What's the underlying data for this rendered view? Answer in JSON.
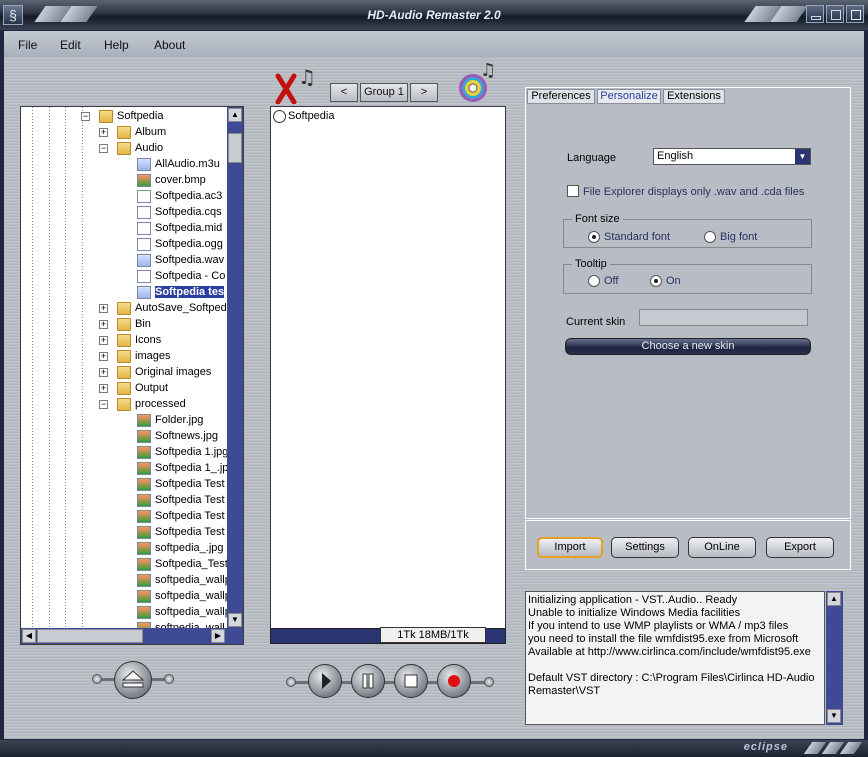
{
  "window": {
    "title": "HD-Audio Remaster 2.0",
    "brand": "eclipse"
  },
  "menu": [
    "File",
    "Edit",
    "Help",
    "About"
  ],
  "tree": {
    "items": [
      {
        "label": "Softpedia",
        "level": 0,
        "type": "folder",
        "expander": "minus"
      },
      {
        "label": "Album",
        "level": 1,
        "type": "folder",
        "expander": "plus"
      },
      {
        "label": "Audio",
        "level": 1,
        "type": "folder",
        "expander": "minus"
      },
      {
        "label": "AllAudio.m3u",
        "level": 2,
        "type": "file-blue"
      },
      {
        "label": "cover.bmp",
        "level": 2,
        "type": "file-img"
      },
      {
        "label": "Softpedia.ac3",
        "level": 2,
        "type": "file"
      },
      {
        "label": "Softpedia.cqs",
        "level": 2,
        "type": "file-plain"
      },
      {
        "label": "Softpedia.mid",
        "level": 2,
        "type": "file"
      },
      {
        "label": "Softpedia.ogg",
        "level": 2,
        "type": "file"
      },
      {
        "label": "Softpedia.wav",
        "level": 2,
        "type": "file-blue"
      },
      {
        "label": "Softpedia - Co",
        "level": 2,
        "type": "file"
      },
      {
        "label": "Softpedia tes",
        "level": 2,
        "type": "file-blue",
        "selected": true
      },
      {
        "label": "AutoSave_Softped",
        "level": 1,
        "type": "folder",
        "expander": "plus"
      },
      {
        "label": "Bin",
        "level": 1,
        "type": "folder",
        "expander": "plus"
      },
      {
        "label": "Icons",
        "level": 1,
        "type": "folder",
        "expander": "plus"
      },
      {
        "label": "images",
        "level": 1,
        "type": "folder",
        "expander": "plus"
      },
      {
        "label": "Original images",
        "level": 1,
        "type": "folder",
        "expander": "plus"
      },
      {
        "label": "Output",
        "level": 1,
        "type": "folder",
        "expander": "plus"
      },
      {
        "label": "processed",
        "level": 1,
        "type": "folder",
        "expander": "minus"
      },
      {
        "label": "Folder.jpg",
        "level": 2,
        "type": "file-img"
      },
      {
        "label": "Softnews.jpg",
        "level": 2,
        "type": "file-img"
      },
      {
        "label": "Softpedia 1.jpg",
        "level": 2,
        "type": "file-img"
      },
      {
        "label": "Softpedia 1_.jp",
        "level": 2,
        "type": "file-img"
      },
      {
        "label": "Softpedia Test",
        "level": 2,
        "type": "file-img"
      },
      {
        "label": "Softpedia Test",
        "level": 2,
        "type": "file-img"
      },
      {
        "label": "Softpedia Test",
        "level": 2,
        "type": "file-img"
      },
      {
        "label": "Softpedia Test",
        "level": 2,
        "type": "file-img"
      },
      {
        "label": "softpedia_.jpg",
        "level": 2,
        "type": "file-img"
      },
      {
        "label": "Softpedia_Test",
        "level": 2,
        "type": "file-img"
      },
      {
        "label": "softpedia_wallp",
        "level": 2,
        "type": "file-img"
      },
      {
        "label": "softpedia_wallp",
        "level": 2,
        "type": "file-img"
      },
      {
        "label": "softpedia_wallp",
        "level": 2,
        "type": "file-img"
      },
      {
        "label": "softpedia_wall",
        "level": 2,
        "type": "file-img"
      }
    ]
  },
  "group": {
    "prev": "<",
    "name": "Group 1",
    "next": ">"
  },
  "playlist": {
    "items": [
      "Softpedia"
    ],
    "status": "1Tk 18MB/1Tk"
  },
  "tabs": [
    "Preferences",
    "Personalize",
    "Extensions"
  ],
  "active_tab": "Personalize",
  "personalize": {
    "language_label": "Language",
    "language_value": "English",
    "file_explorer_label": "File Explorer displays only .wav and .cda files",
    "font_size": {
      "caption": "Font size",
      "standard": "Standard font",
      "big": "Big font",
      "selected": "standard"
    },
    "tooltip": {
      "caption": "Tooltip",
      "off": "Off",
      "on": "On",
      "selected": "on"
    },
    "current_skin_label": "Current skin",
    "current_skin_value": "",
    "choose_skin": "Choose a new skin"
  },
  "actions": [
    "Import",
    "Settings",
    "OnLine",
    "Export"
  ],
  "log": [
    "Initializing application - VST..Audio.. Ready",
    "Unable to initialize Windows Media facilities",
    "If you intend to use WMP playlists or WMA / mp3 files",
    "you need to install the file wmfdist95.exe from Microsoft",
    "Available at http://www.cirlinca.com/include/wmfdist95.exe",
    "",
    "Default VST directory : C:\\Program Files\\Cirlinca HD-Audio",
    "Remaster\\VST"
  ],
  "colors": {
    "scrollbar": "#3e4a95",
    "selection": "#2a3fa0",
    "record": "#e01010"
  }
}
